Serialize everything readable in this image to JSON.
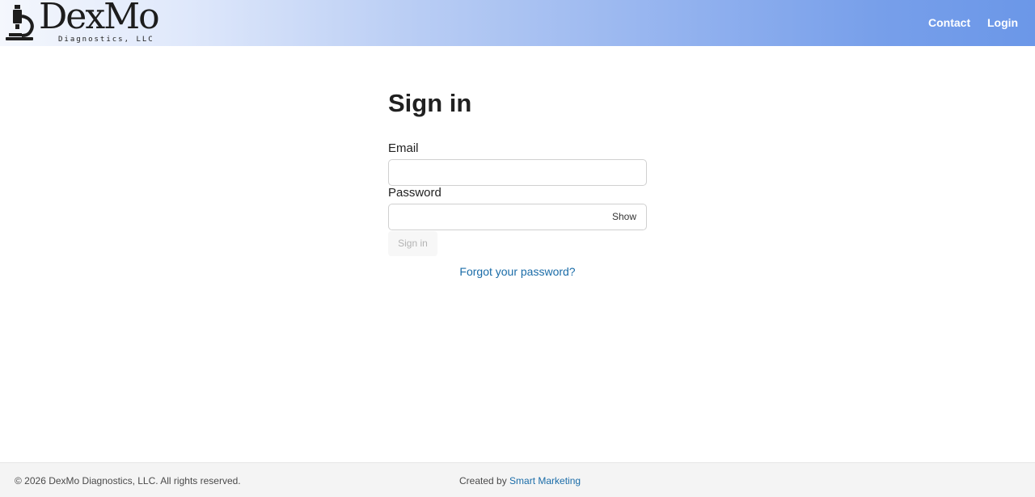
{
  "header": {
    "logo": {
      "wordmark": "DexMo",
      "subtitle": "Diagnostics, LLC",
      "icon": "microscope-icon"
    },
    "nav": {
      "contact_label": "Contact",
      "login_label": "Login"
    },
    "colors": {
      "gradient_start": "#f4f7fd",
      "gradient_end": "#6b97e8"
    }
  },
  "form": {
    "title": "Sign in",
    "email": {
      "label": "Email",
      "value": "",
      "placeholder": ""
    },
    "password": {
      "label": "Password",
      "value": "",
      "placeholder": "",
      "toggle_label": "Show"
    },
    "submit_label": "Sign in",
    "forgot_label": "Forgot your password?"
  },
  "footer": {
    "copyright": "© 2026 DexMo Diagnostics, LLC. All rights reserved.",
    "credit_prefix": "Created by",
    "credit_link": "Smart Marketing"
  },
  "colors": {
    "link": "#1a6ca8",
    "nav_text": "#ffffff",
    "footer_bg": "#f4f4f4"
  }
}
